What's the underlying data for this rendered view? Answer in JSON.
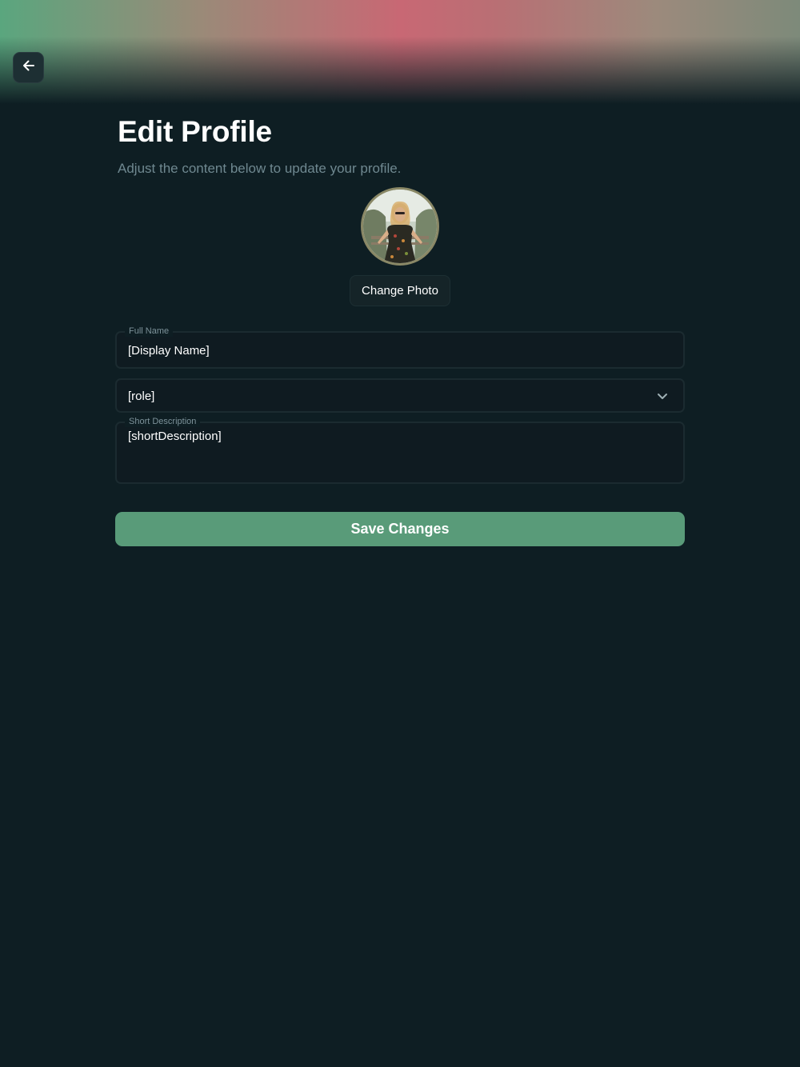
{
  "header": {
    "back_icon": "arrow-left-icon",
    "title": "Edit Profile",
    "subtitle": "Adjust the content below to update your profile."
  },
  "avatar": {
    "change_photo_label": "Change Photo"
  },
  "form": {
    "full_name": {
      "label": "Full Name",
      "value": "[Display Name]"
    },
    "role": {
      "value": "[role]",
      "icon": "chevron-down-icon"
    },
    "short_description": {
      "label": "Short Description",
      "value": "[shortDescription]"
    },
    "save_label": "Save Changes"
  },
  "colors": {
    "background": "#0e1e23",
    "accent": "#599b79",
    "field_bg": "#0f1b21",
    "muted_text": "#6f8890"
  }
}
